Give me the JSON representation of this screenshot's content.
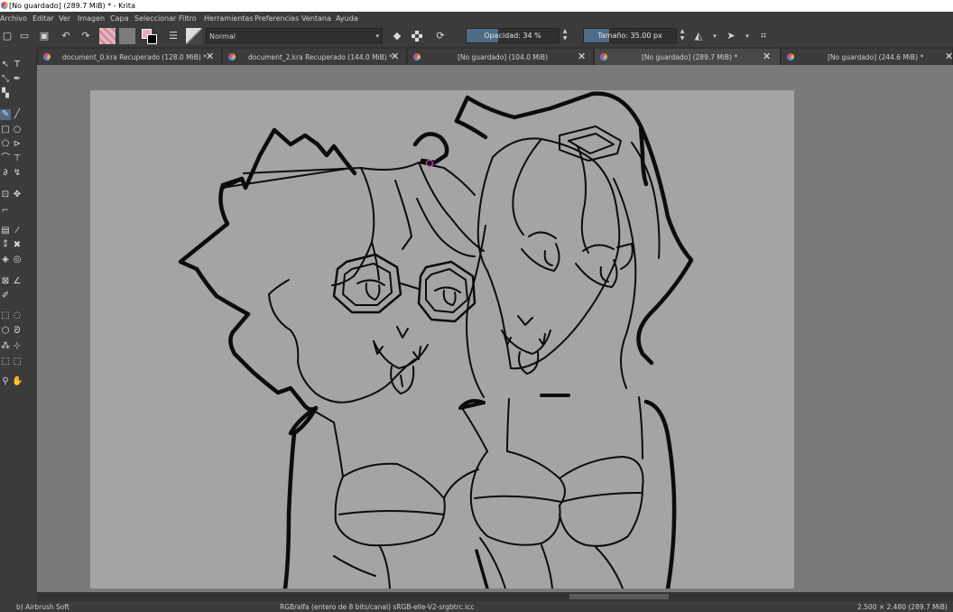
{
  "window": {
    "title": "[No guardado]  (289.7 MiB) * - Krita"
  },
  "menu": {
    "items": [
      "Archivo",
      "Editar",
      "Ver",
      "Imagen",
      "Capa",
      "Seleccionar",
      "Filtro",
      "Herramientas",
      "Preferencias",
      "Ventana",
      "Ayuda"
    ]
  },
  "toolbar": {
    "blend_mode": "Normal",
    "opacity_label": "Opacidad: 34 %",
    "opacity_value": 0.34,
    "size_label": "Tamaño: 35.00 px",
    "size_value": 0.27
  },
  "tabs": [
    {
      "label": "document_0.kra Recuperado (128.0 MiB) *",
      "active": false
    },
    {
      "label": "document_2.kra Recuperado (144.0 MiB) *",
      "active": false
    },
    {
      "label": "[No guardado]  (104.0 MiB)",
      "active": false
    },
    {
      "label": "[No guardado]  (289.7 MiB) *",
      "active": true
    },
    {
      "label": "[No guardado]  (244.6 MiB) *",
      "active": false
    }
  ],
  "status": {
    "brush": "b) Airbrush Soft",
    "color_info": "RGB/alfa (entero de 8 bits/canal)  sRGB-elle-V2-srgbtrc.icc",
    "dimensions": "2.500 × 2.480 (289.7 MiB)"
  },
  "colors": {
    "accent": "#506b85",
    "ui_bg": "#3b3b3b",
    "canvas_bg": "#7a7a7a",
    "paper": "#a4a4a4"
  }
}
